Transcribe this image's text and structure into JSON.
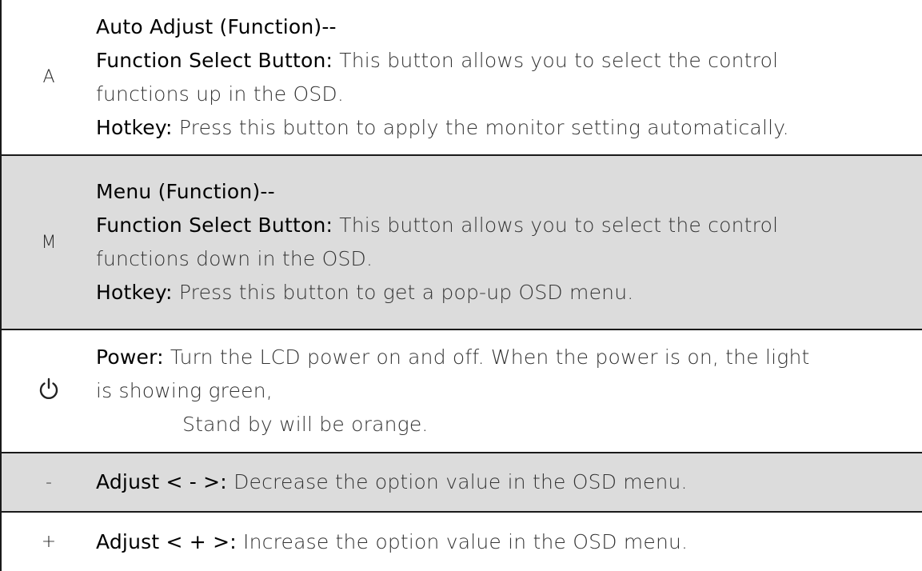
{
  "rows": [
    {
      "key": "A",
      "heading": "Auto Adjust (Function)--",
      "lines": [
        {
          "term": "Function Select Button:",
          "text": " This button allows you to select the control"
        },
        {
          "text": "functions up in the OSD."
        },
        {
          "term": "Hotkey:",
          "text": " Press this button to apply the monitor setting automatically."
        }
      ]
    },
    {
      "key": "M",
      "heading": "Menu (Function)--",
      "lines": [
        {
          "term": "Function Select Button:",
          "text": " This button allows you to select the control"
        },
        {
          "text": "functions down in the OSD."
        },
        {
          "term": "Hotkey:",
          "text": " Press this button to get a pop-up OSD menu."
        }
      ]
    },
    {
      "key_icon": "power-icon",
      "lines": [
        {
          "term": "Power:",
          "text": " Turn the LCD power on and off. When the power is on, the light"
        },
        {
          "text": "is showing green,"
        },
        {
          "text": "Stand by will be orange."
        }
      ]
    },
    {
      "key": "-",
      "lines": [
        {
          "term": "Adjust < - >:",
          "text": " Decrease the option value in the OSD menu."
        }
      ]
    },
    {
      "key": "+",
      "lines": [
        {
          "term": "Adjust < + >:",
          "text": " Increase the option value in the OSD menu."
        }
      ]
    }
  ],
  "colors": {
    "shaded_row": "#dcdcdc",
    "border": "#1a1a1a"
  }
}
